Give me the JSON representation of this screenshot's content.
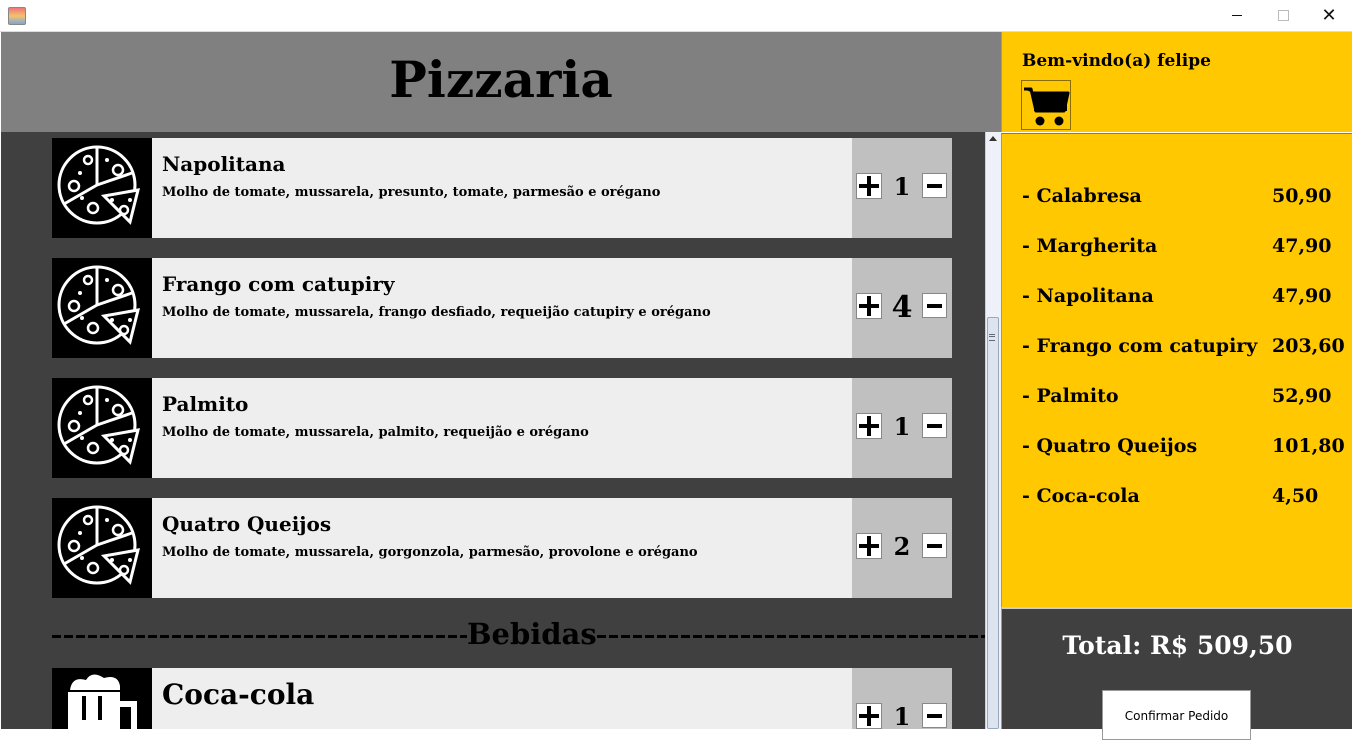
{
  "window": {
    "icon": "java-cup-icon",
    "minimize": "—",
    "maximize": "☐",
    "close": "✕"
  },
  "header": {
    "title": "Pizzaria"
  },
  "menu": {
    "items": [
      {
        "name": "Napolitana",
        "description": "Molho de tomate, mussarela, presunto, tomate, parmesão e orégano",
        "qty": "1",
        "icon": "pizza-icon"
      },
      {
        "name": "Frango com catupiry",
        "description": "Molho de tomate, mussarela, frango desfiado, requeijão catupiry e orégano",
        "qty": "4",
        "icon": "pizza-icon"
      },
      {
        "name": "Palmito",
        "description": "Molho de tomate, mussarela, palmito, requeijão e orégano",
        "qty": "1",
        "icon": "pizza-icon"
      },
      {
        "name": "Quatro Queijos",
        "description": "Molho de tomate, mussarela, gorgonzola, parmesão, provolone e orégano",
        "qty": "2",
        "icon": "pizza-icon"
      }
    ],
    "section_label": "Bebidas",
    "drink": {
      "name": "Coca-cola",
      "qty": "1",
      "icon": "drink-mug-icon"
    }
  },
  "sidebar": {
    "welcome": "Bem-vindo(a) felipe",
    "cart_icon": "shopping-cart-icon",
    "order": [
      {
        "label": "- Calabresa",
        "price": "50,90"
      },
      {
        "label": "- Margherita",
        "price": "47,90"
      },
      {
        "label": "- Napolitana",
        "price": "47,90"
      },
      {
        "label": "- Frango com catupiry",
        "price": "203,60"
      },
      {
        "label": "- Palmito",
        "price": "52,90"
      },
      {
        "label": "- Quatro Queijos",
        "price": "101,80"
      },
      {
        "label": "- Coca-cola",
        "price": "4,50"
      }
    ],
    "total": "Total: R$ 509,50",
    "confirm_label": "Confirmar Pedido"
  },
  "colors": {
    "header": "#808080",
    "menu_bg": "#404040",
    "sidebar": "#ffc800",
    "item_bg": "#eeeeee",
    "control_bg": "#c0c0c0"
  }
}
